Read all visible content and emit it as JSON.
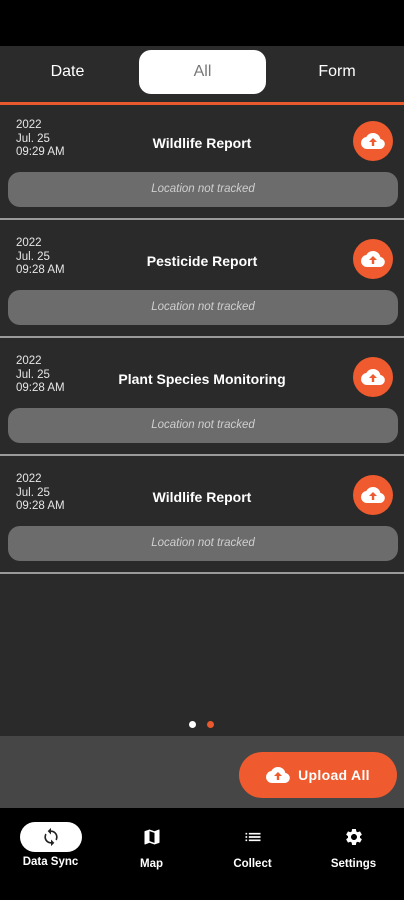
{
  "tabs": {
    "date": "Date",
    "all": "All",
    "form": "Form"
  },
  "records": [
    {
      "year": "2022",
      "day": "Jul. 25",
      "time": "09:29 AM",
      "title": "Wildlife Report",
      "location": "Location not tracked"
    },
    {
      "year": "2022",
      "day": "Jul. 25",
      "time": "09:28 AM",
      "title": "Pesticide Report",
      "location": "Location not tracked"
    },
    {
      "year": "2022",
      "day": "Jul. 25",
      "time": "09:28 AM",
      "title": "Plant Species Monitoring",
      "location": "Location not tracked"
    },
    {
      "year": "2022",
      "day": "Jul. 25",
      "time": "09:28 AM",
      "title": "Wildlife Report",
      "location": "Location not tracked"
    }
  ],
  "pager": {
    "total": 2,
    "active": 2
  },
  "upload_all": {
    "label": "Upload All",
    "icon": "cloud-upload-icon"
  },
  "nav": [
    {
      "label": "Data Sync",
      "icon": "sync-icon",
      "active": true
    },
    {
      "label": "Map",
      "icon": "map-icon",
      "active": false
    },
    {
      "label": "Collect",
      "icon": "list-icon",
      "active": false
    },
    {
      "label": "Settings",
      "icon": "gear-icon",
      "active": false
    }
  ],
  "colors": {
    "accent": "#ef5a2e",
    "background": "#2a2a2a",
    "location_bar": "#6c6c6c"
  }
}
